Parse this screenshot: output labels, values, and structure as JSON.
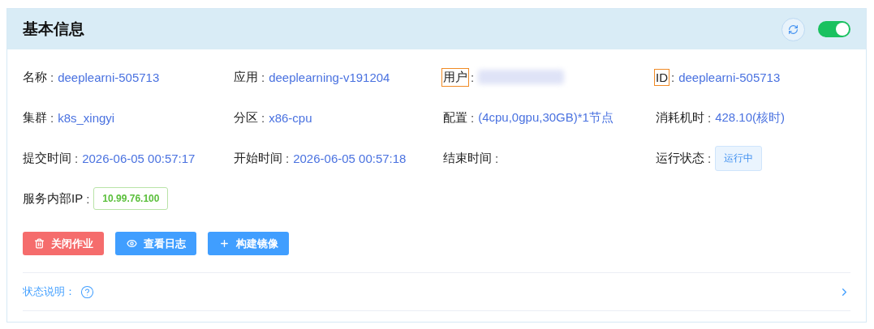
{
  "header": {
    "title": "基本信息",
    "switch": {
      "on": true
    }
  },
  "fields": [
    {
      "label": "名称",
      "colon": ":",
      "value": "deeplearni-505713",
      "kind": "text",
      "highlighted": false
    },
    {
      "label": "应用",
      "colon": ":",
      "value": "deeplearning-v191204",
      "kind": "text",
      "highlighted": false
    },
    {
      "label": "用户",
      "colon": ":",
      "kind": "redacted",
      "highlighted": true
    },
    {
      "label": "ID",
      "colon": ":",
      "value": "deeplearni-505713",
      "kind": "text",
      "highlighted": true
    },
    {
      "label": "集群",
      "colon": ":",
      "value": "k8s_xingyi",
      "kind": "text",
      "highlighted": false
    },
    {
      "label": "分区",
      "colon": ":",
      "value": "x86-cpu",
      "kind": "text",
      "highlighted": false
    },
    {
      "label": "配置",
      "colon": ":",
      "value": "(4cpu,0gpu,30GB)*1节点",
      "kind": "text",
      "highlighted": false
    },
    {
      "label": "消耗机时",
      "colon": ":",
      "value": "428.10(核时)",
      "kind": "text",
      "highlighted": false
    },
    {
      "label": "提交时间",
      "colon": ":",
      "value": "2026-06-05 00:57:17",
      "kind": "text",
      "highlighted": false
    },
    {
      "label": "开始时间",
      "colon": ":",
      "value": "2026-06-05 00:57:18",
      "kind": "text",
      "highlighted": false
    },
    {
      "label": "结束时间",
      "colon": ":",
      "kind": "empty",
      "highlighted": false
    },
    {
      "label": "运行状态",
      "colon": ":",
      "value": "运行中",
      "kind": "status",
      "highlighted": false
    },
    {
      "label": "服务内部IP",
      "colon": ":",
      "value": "10.99.76.100",
      "kind": "ip",
      "highlighted": false
    }
  ],
  "buttons": [
    {
      "label": "关闭作业",
      "kind": "danger"
    },
    {
      "label": "查看日志",
      "kind": "primary"
    },
    {
      "label": "构建镜像",
      "kind": "primary"
    }
  ],
  "status_note": {
    "label": "状态说明：",
    "expanded": false
  }
}
